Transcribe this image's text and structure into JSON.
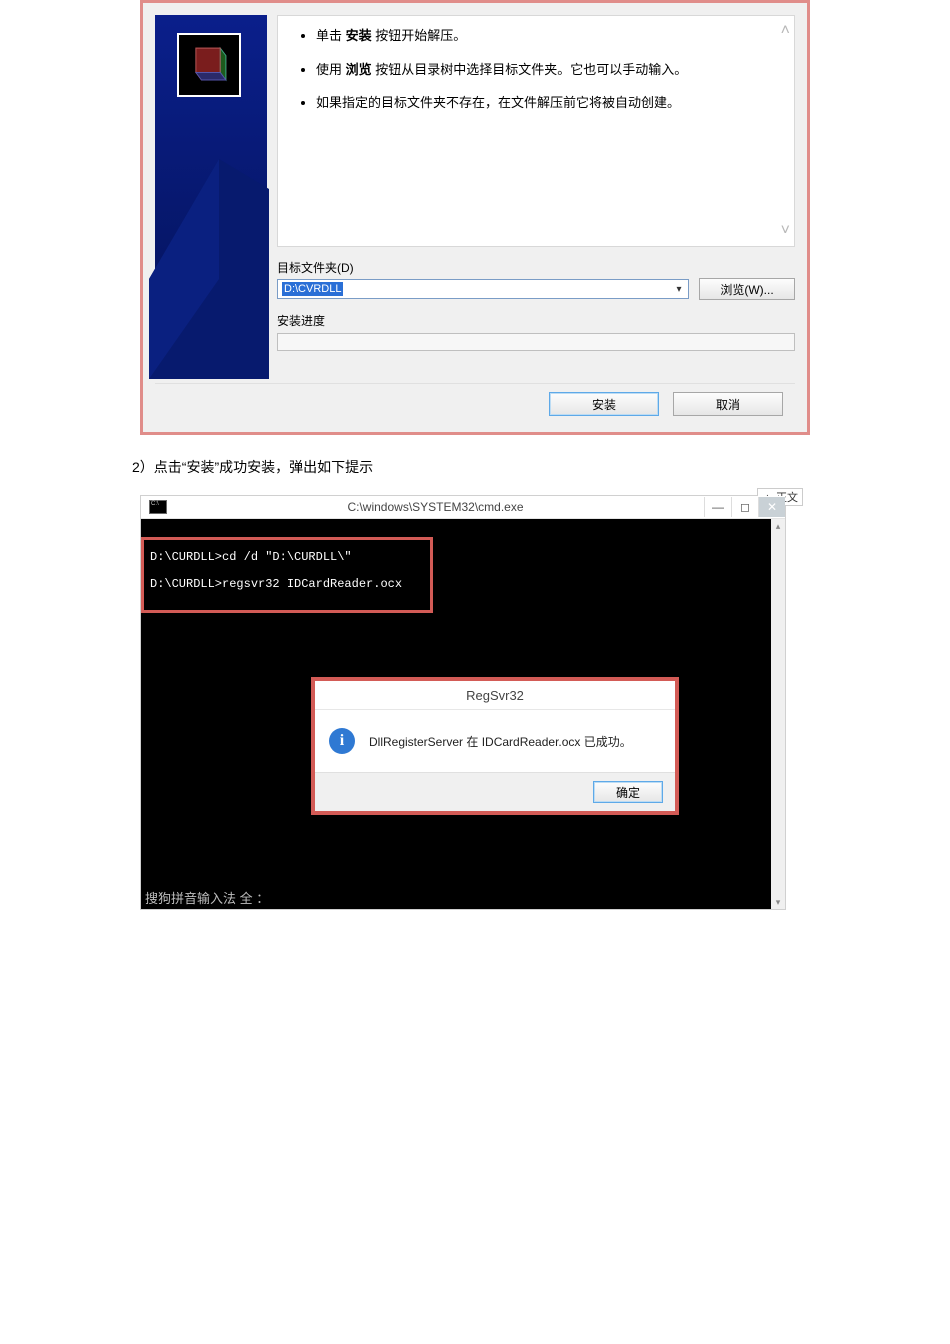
{
  "installer": {
    "bullets": [
      {
        "prefix": "单击 ",
        "bold": "安装",
        "suffix": " 按钮开始解压。"
      },
      {
        "prefix": "使用 ",
        "bold": "浏览",
        "suffix": " 按钮从目录树中选择目标文件夹。它也可以手动输入。"
      },
      {
        "prefix": "",
        "bold": "",
        "suffix": "如果指定的目标文件夹不存在，在文件解压前它将被自动创建。"
      }
    ],
    "dest_label": "目标文件夹(D)",
    "dest_value": "D:\\CVRDLL",
    "browse_label": "浏览(W)...",
    "progress_label": "安装进度",
    "install_label": "安装",
    "cancel_label": "取消"
  },
  "caption_text": "2）点击“安装”成功安装，弹出如下提示",
  "cmd": {
    "title": "C:\\windows\\SYSTEM32\\cmd.exe",
    "line1": "D:\\CURDLL>cd /d \"D:\\CURDLL\\\"",
    "line2": "D:\\CURDLL>regsvr32 IDCardReader.ocx",
    "ime_line": "搜狗拼音输入法 全 ：",
    "tab_fragment": "▲ 正文"
  },
  "regsvr": {
    "title": "RegSvr32",
    "message": "DllRegisterServer 在 IDCardReader.ocx 已成功。",
    "ok_label": "确定"
  }
}
